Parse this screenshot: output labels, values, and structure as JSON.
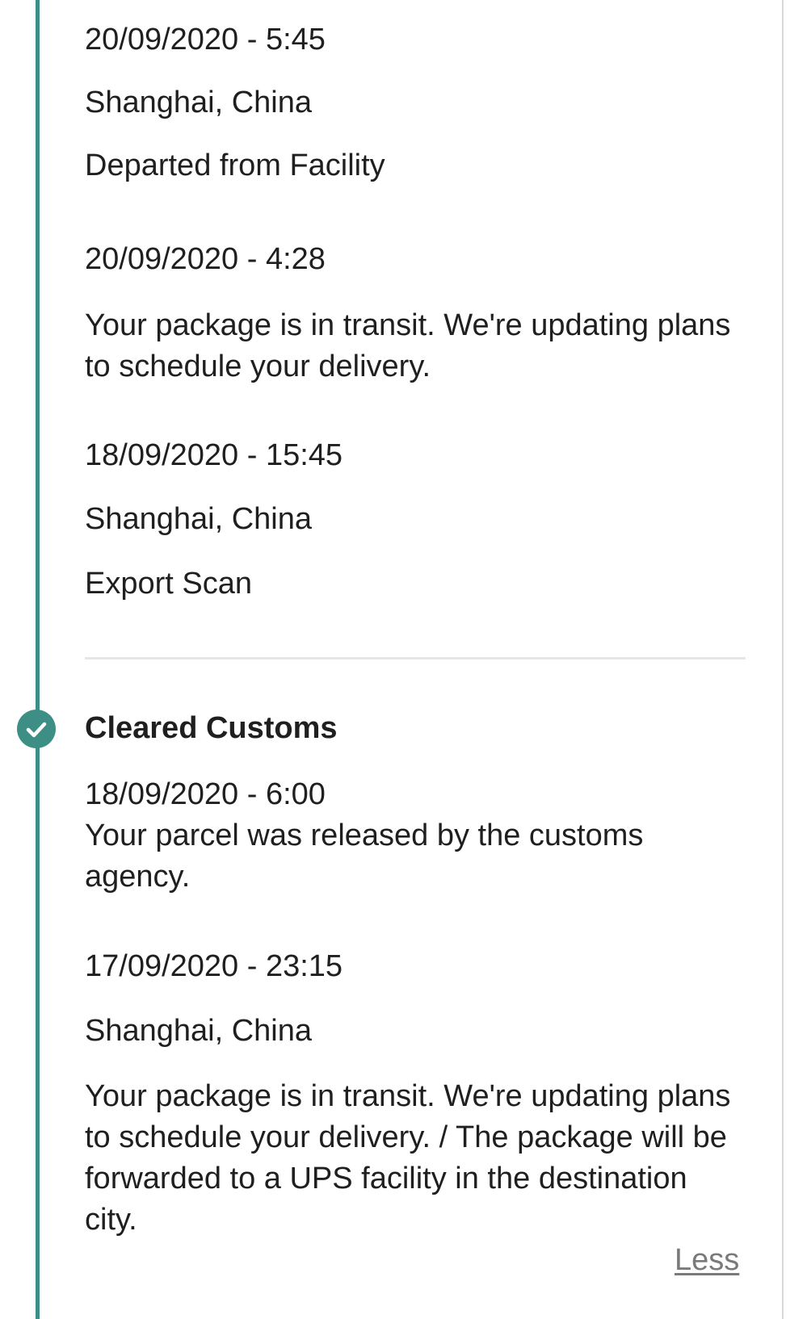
{
  "events": [
    {
      "timestamp": "20/09/2020 - 5:45",
      "location": "Shanghai, China",
      "description": "Departed from Facility"
    },
    {
      "timestamp": "20/09/2020 - 4:28",
      "description": "Your package is in transit. We're updating plans to schedule your delivery."
    },
    {
      "timestamp": "18/09/2020 - 15:45",
      "location": "Shanghai, China",
      "description": "Export Scan"
    }
  ],
  "milestone": {
    "title": "Cleared Customs",
    "icon": "checkmark-circle-icon",
    "events": [
      {
        "timestamp": "18/09/2020 - 6:00",
        "description": "Your parcel was released by the customs agency."
      },
      {
        "timestamp": "17/09/2020 - 23:15",
        "location": "Shanghai, China",
        "description": "Your package is in transit. We're updating plans to schedule your delivery. / The package will be forwarded to a UPS facility in the destination city."
      }
    ]
  },
  "less_link": "Less",
  "colors": {
    "accent": "#3d8f86",
    "text": "#1f1f1f",
    "muted_link": "#7a7a7a",
    "divider": "#e6e6e6"
  }
}
